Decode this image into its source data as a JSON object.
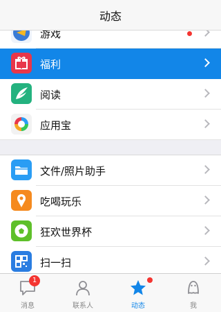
{
  "header": {
    "title": "动态"
  },
  "groups": [
    {
      "items": [
        {
          "label": "游戏",
          "icon": "game-icon",
          "has_dot": true
        },
        {
          "label": "福利",
          "icon": "gift-icon",
          "selected": true
        },
        {
          "label": "阅读",
          "icon": "reading-icon"
        },
        {
          "label": "应用宝",
          "icon": "app-store-icon"
        }
      ]
    },
    {
      "items": [
        {
          "label": "文件/照片助手",
          "icon": "folder-icon"
        },
        {
          "label": "吃喝玩乐",
          "icon": "food-icon"
        },
        {
          "label": "狂欢世界杯",
          "icon": "soccer-icon"
        },
        {
          "label": "扫一扫",
          "icon": "qr-scan-icon"
        }
      ]
    }
  ],
  "tabbar": {
    "tabs": [
      {
        "label": "消息",
        "icon": "message-bubble-icon",
        "badge": "1"
      },
      {
        "label": "联系人",
        "icon": "contacts-icon"
      },
      {
        "label": "动态",
        "icon": "star-icon",
        "active": true,
        "dot": true
      },
      {
        "label": "我",
        "icon": "me-icon"
      }
    ]
  },
  "colors": {
    "accent": "#1286e8",
    "badge": "#f43531",
    "background": "#efeff4"
  }
}
